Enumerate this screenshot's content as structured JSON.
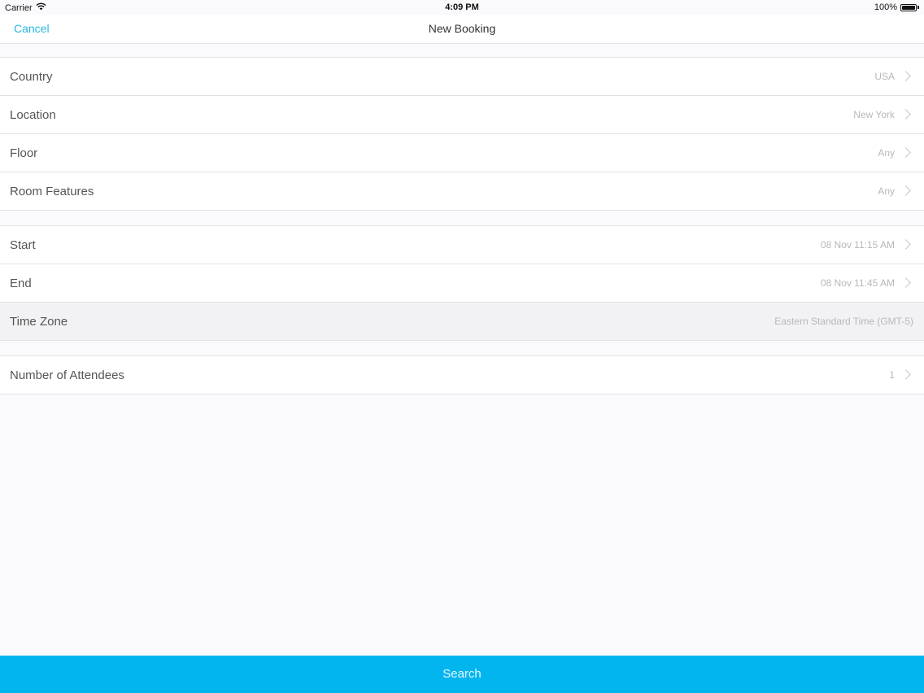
{
  "status_bar": {
    "carrier": "Carrier",
    "time": "4:09 PM",
    "battery": "100%",
    "battery_level": 1.0
  },
  "nav": {
    "cancel_label": "Cancel",
    "title": "New Booking"
  },
  "sections": [
    {
      "rows": [
        {
          "label": "Country",
          "value": "USA",
          "chevron": true
        },
        {
          "label": "Location",
          "value": "New York",
          "chevron": true
        },
        {
          "label": "Floor",
          "value": "Any",
          "chevron": true
        },
        {
          "label": "Room Features",
          "value": "Any",
          "chevron": true
        }
      ]
    },
    {
      "rows": [
        {
          "label": "Start",
          "value": "08 Nov 11:15 AM",
          "chevron": true
        },
        {
          "label": "End",
          "value": "08 Nov 11:45 AM",
          "chevron": true
        },
        {
          "label": "Time Zone",
          "value": "Eastern Standard Time (GMT-5)",
          "chevron": false,
          "highlighted": true
        }
      ]
    },
    {
      "rows": [
        {
          "label": "Number of Attendees",
          "value": "1",
          "chevron": true
        }
      ]
    }
  ],
  "search_button": {
    "label": "Search"
  },
  "colors": {
    "accent": "#2ab6e0",
    "search_button_bg": "#02b5ef"
  },
  "icons": [
    "wifi-icon",
    "battery-icon",
    "chevron-right-icon"
  ]
}
